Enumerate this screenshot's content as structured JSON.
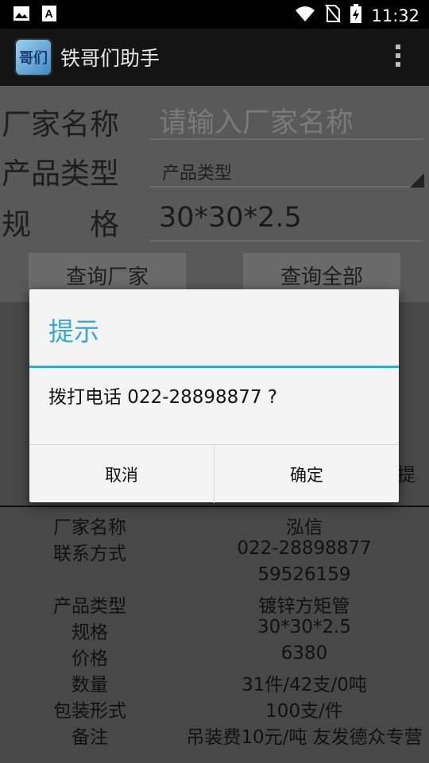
{
  "status_bar": {
    "time": "11:32",
    "icons": [
      "image-icon",
      "a-text-icon",
      "wifi-icon",
      "no-sim-icon",
      "battery-charging-icon"
    ]
  },
  "app_bar": {
    "icon_text": "哥们",
    "title": "铁哥们助手",
    "overflow_icon": "more-vert-icon"
  },
  "form": {
    "manufacturer_label": "厂家名称",
    "manufacturer_placeholder": "请输入厂家名称",
    "product_type_label": "产品类型",
    "product_type_selected": "产品类型",
    "spec_label": "规　　格",
    "spec_value": "30*30*2.5",
    "query_manufacturer_button": "查询厂家",
    "query_all_button": "查询全部"
  },
  "partial_text": "提",
  "result": [
    {
      "key": "厂家名称",
      "value": "泓信"
    },
    {
      "key": "联系方式",
      "value": "022-28898877"
    },
    {
      "key": "",
      "value": "59526159"
    },
    {
      "key": "产品类型",
      "value": "镀锌方矩管"
    },
    {
      "key": "规格",
      "value": "30*30*2.5"
    },
    {
      "key": "价格",
      "value": "6380"
    },
    {
      "key": "数量",
      "value": "31件/42支/0吨"
    },
    {
      "key": "包装形式",
      "value": "100支/件"
    },
    {
      "key": "备注",
      "value": "吊装费10元/吨 友发德众专营"
    }
  ],
  "dialog": {
    "title": "提示",
    "message": "拨打电话 022-28898877 ?",
    "cancel_label": "取消",
    "confirm_label": "确定"
  },
  "colors": {
    "accent": "#35a9d5",
    "dialog_bg": "#f4f4f4",
    "action_bar": "#141414"
  }
}
